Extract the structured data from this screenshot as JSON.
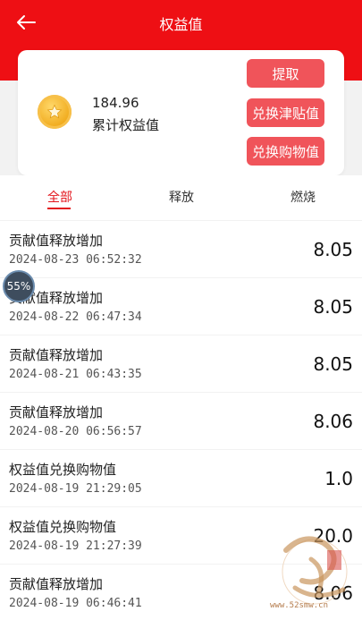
{
  "header": {
    "title": "权益值"
  },
  "summary": {
    "value": "184.96",
    "label": "累计权益值",
    "buttons": [
      "提取",
      "兑换津贴值",
      "兑换购物值"
    ]
  },
  "tabs": [
    {
      "label": "全部",
      "active": true
    },
    {
      "label": "释放",
      "active": false
    },
    {
      "label": "燃烧",
      "active": false
    }
  ],
  "records": [
    {
      "title": "贡献值释放增加",
      "date": "2024-08-23 06:52:32",
      "amount": "8.05"
    },
    {
      "title": "贡献值释放增加",
      "date": "2024-08-22 06:47:34",
      "amount": "8.05"
    },
    {
      "title": "贡献值释放增加",
      "date": "2024-08-21 06:43:35",
      "amount": "8.05"
    },
    {
      "title": "贡献值释放增加",
      "date": "2024-08-20 06:56:57",
      "amount": "8.06"
    },
    {
      "title": "权益值兑换购物值",
      "date": "2024-08-19 21:29:05",
      "amount": "1.0"
    },
    {
      "title": "权益值兑换购物值",
      "date": "2024-08-19 21:27:39",
      "amount": "20.0"
    },
    {
      "title": "贡献值释放增加",
      "date": "2024-08-19 06:46:41",
      "amount": "8.06"
    }
  ],
  "overlay_badge": "55%",
  "watermark": {
    "text": "www.52smw.cn"
  },
  "colors": {
    "header": "#ee0f14",
    "button": "#f0545a",
    "tab_active": "#e3161d",
    "background": "#f2f2f2"
  }
}
